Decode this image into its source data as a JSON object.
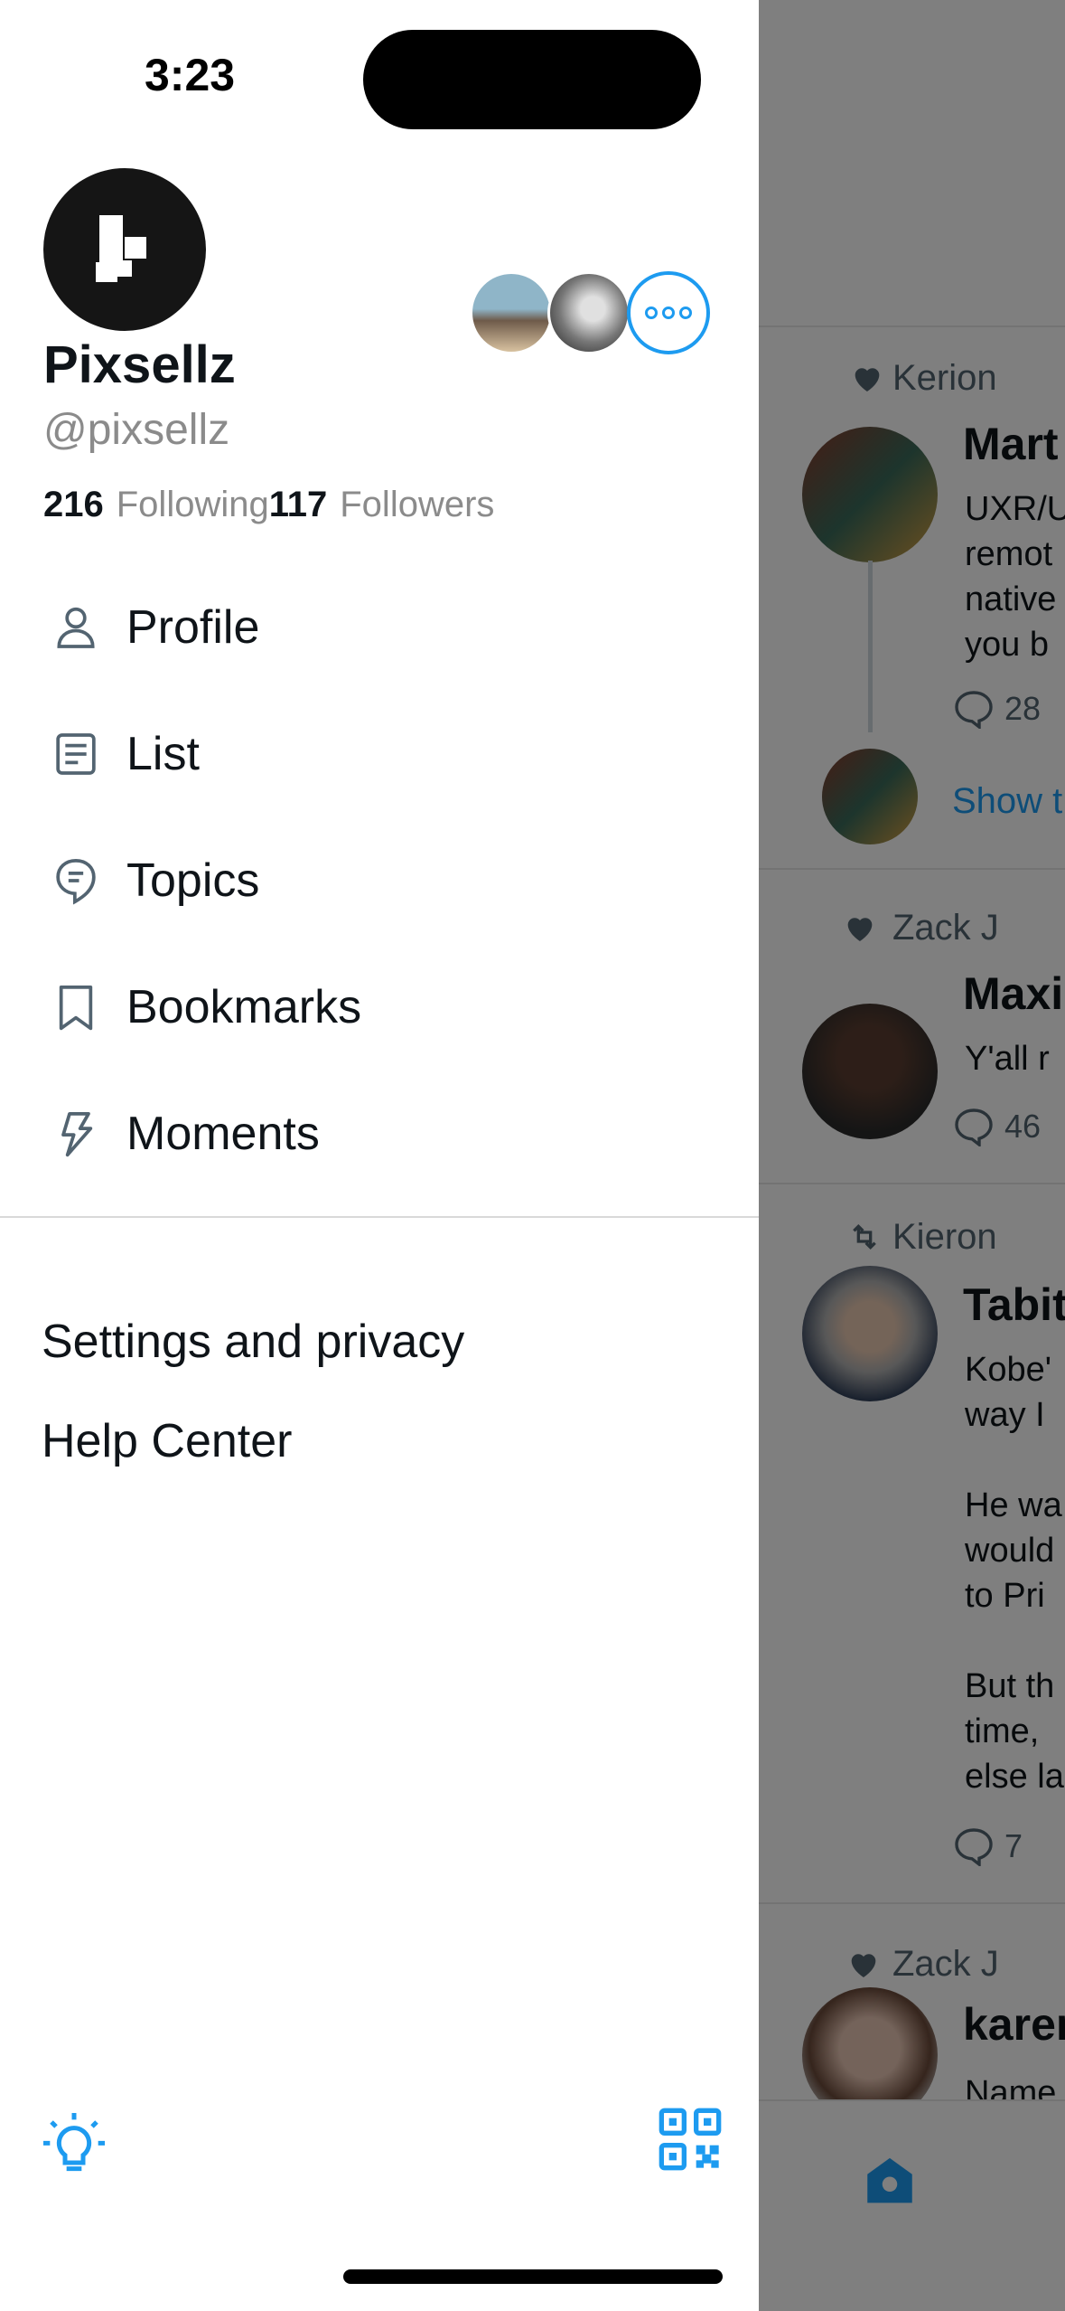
{
  "status_bar": {
    "time": "3:23"
  },
  "drawer": {
    "display_name": "Pixsellz",
    "handle": "@pixsellz",
    "following_count": "216",
    "following_label": "Following",
    "followers_count": "117",
    "followers_label": "Followers",
    "menu": [
      {
        "label": "Profile",
        "icon": "person-icon"
      },
      {
        "label": "List",
        "icon": "list-icon"
      },
      {
        "label": "Topics",
        "icon": "topics-icon"
      },
      {
        "label": "Bookmarks",
        "icon": "bookmark-icon"
      },
      {
        "label": "Moments",
        "icon": "lightning-icon"
      }
    ],
    "links": [
      "Settings and privacy",
      "Help Center"
    ],
    "accent": "#1d9bf0"
  },
  "timeline": {
    "tweets": [
      {
        "meta": "Kerion",
        "meta_icon": "heart-icon",
        "name": "Mart",
        "body": "UXR/U\nremot\nnative\nyou b",
        "replies": "28",
        "show_thread": "Show t"
      },
      {
        "meta": "Zack J",
        "meta_icon": "heart-icon",
        "name": "Maxi",
        "body": "Y'all r",
        "replies": "46"
      },
      {
        "meta": "Kieron",
        "meta_icon": "retweet-icon",
        "name": "Tabit",
        "body": "Kobe'\nway I\n\nHe wa\nwould\nto Pri\n\nBut th\ntime,\nelse la",
        "replies": "7"
      },
      {
        "meta": "Zack J",
        "meta_icon": "heart-icon",
        "name": "karen",
        "body": "Name"
      }
    ]
  }
}
